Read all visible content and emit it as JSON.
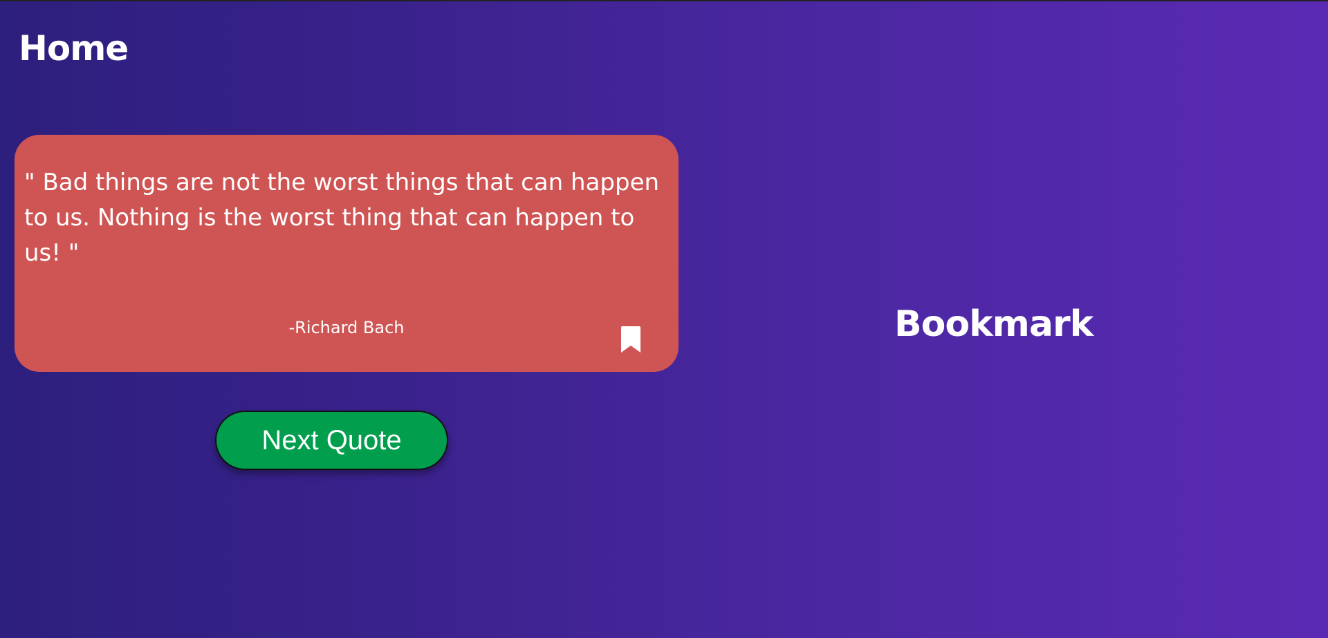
{
  "header": {
    "title": "Home"
  },
  "quote_card": {
    "text": "\" Bad things are not the worst things that can happen to us. Nothing is the worst thing that can happen to us! \"",
    "author": "-Richard Bach",
    "bookmark_icon": "bookmark-icon",
    "background_color": "#cf5554"
  },
  "actions": {
    "next_label": "Next Quote",
    "button_color": "#019e4e"
  },
  "bookmark_panel": {
    "heading": "Bookmark"
  },
  "theme": {
    "gradient_start": "#2d1f7d",
    "gradient_end": "#5a2ab4"
  }
}
